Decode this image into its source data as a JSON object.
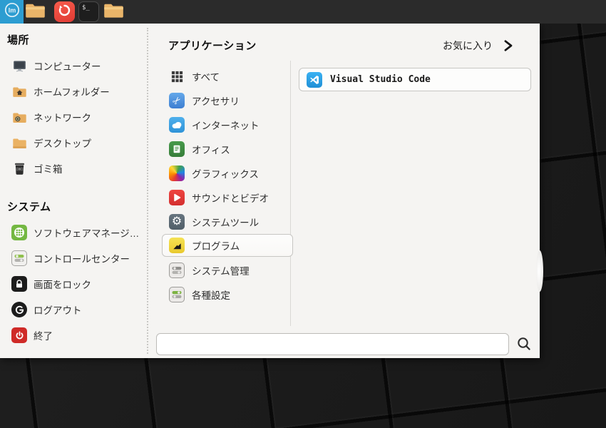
{
  "taskbar": {
    "menu_button": {
      "icon": "mint-logo-icon"
    },
    "launchers": [
      {
        "icon": "folder-icon"
      },
      {
        "icon": "firefox-icon"
      },
      {
        "icon": "terminal-icon",
        "glyph": "$_"
      },
      {
        "icon": "folder-icon"
      }
    ]
  },
  "menu": {
    "places": {
      "header": "場所",
      "items": [
        {
          "label": "コンピューター",
          "icon": "computer-icon"
        },
        {
          "label": "ホームフォルダー",
          "icon": "home-folder-icon"
        },
        {
          "label": "ネットワーク",
          "icon": "network-folder-icon"
        },
        {
          "label": "デスクトップ",
          "icon": "desktop-folder-icon"
        },
        {
          "label": "ゴミ箱",
          "icon": "trash-icon"
        }
      ]
    },
    "system": {
      "header": "システム",
      "items": [
        {
          "label": "ソフトウェアマネージ…",
          "icon": "software-manager-icon"
        },
        {
          "label": "コントロールセンター",
          "icon": "control-center-icon"
        },
        {
          "label": "画面をロック",
          "icon": "lock-icon"
        },
        {
          "label": "ログアウト",
          "icon": "logout-icon"
        },
        {
          "label": "終了",
          "icon": "shutdown-icon"
        }
      ]
    },
    "applications": {
      "header": "アプリケーション",
      "categories": [
        {
          "label": "すべて",
          "icon": "all-apps-icon",
          "selected": false
        },
        {
          "label": "アクセサリ",
          "icon": "accessories-icon",
          "selected": false
        },
        {
          "label": "インターネット",
          "icon": "internet-icon",
          "selected": false
        },
        {
          "label": "オフィス",
          "icon": "office-icon",
          "selected": false
        },
        {
          "label": "グラフィックス",
          "icon": "graphics-icon",
          "selected": false
        },
        {
          "label": "サウンドとビデオ",
          "icon": "sound-video-icon",
          "selected": false
        },
        {
          "label": "システムツール",
          "icon": "system-tools-icon",
          "selected": false
        },
        {
          "label": "プログラム",
          "icon": "programs-icon",
          "selected": true
        },
        {
          "label": "システム管理",
          "icon": "administration-icon",
          "selected": false
        },
        {
          "label": "各種設定",
          "icon": "preferences-icon",
          "selected": false
        }
      ]
    },
    "favorites": {
      "header": "お気に入り",
      "apps": [
        {
          "name": "Visual Studio Code",
          "icon": "vscode-icon"
        }
      ]
    },
    "search": {
      "value": "",
      "placeholder": ""
    }
  },
  "colors": {
    "accent_blue": "#2d9dd1",
    "taskbar_bg": "#2b2b2b",
    "panel_bg": "#f5f4f2",
    "selected_border": "#c7c6c3",
    "shutdown_red": "#cf2a27",
    "software_green": "#74b842"
  }
}
